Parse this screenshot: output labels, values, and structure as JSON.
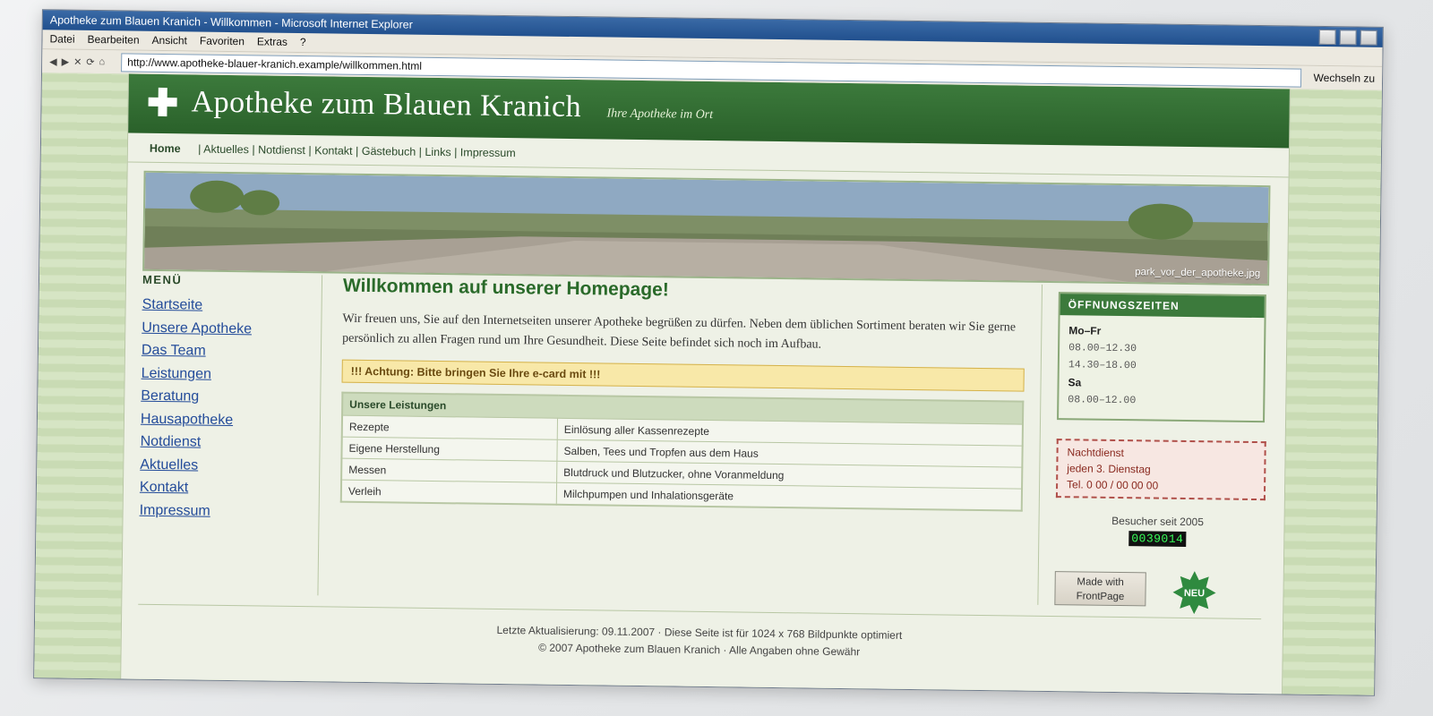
{
  "browser": {
    "window_title": "Apotheke zum Blauen Kranich - Willkommen - Microsoft Internet Explorer",
    "menu": [
      "Datei",
      "Bearbeiten",
      "Ansicht",
      "Favoriten",
      "Extras",
      "?"
    ],
    "nav_icons": [
      "◀",
      "▶",
      "✕",
      "⟳",
      "⌂"
    ],
    "url": "http://www.apotheke-blauer-kranich.example/willkommen.html",
    "go_label": "Wechseln zu"
  },
  "site": {
    "title": "Apotheke zum Blauen Kranich",
    "slogan": "Ihre Apotheke im Ort",
    "brand_green": "#2f6b2f"
  },
  "topnav": {
    "active": "Home",
    "items": [
      "Aktuelles",
      "Notdienst",
      "Kontakt",
      "Gästebuch",
      "Links",
      "Impressum"
    ]
  },
  "banner": {
    "caption": "park_vor_der_apotheke.jpg"
  },
  "leftmenu": {
    "heading": "MENÜ",
    "items": [
      "Startseite",
      "Unsere Apotheke",
      "Das Team",
      "Leistungen",
      "Beratung",
      "Hausapotheke",
      "Notdienst",
      "Aktuelles",
      "Kontakt",
      "Impressum"
    ]
  },
  "main": {
    "heading": "Willkommen auf unserer Homepage!",
    "intro": "Wir freuen uns, Sie auf den Internetseiten unserer Apotheke begrüßen zu dürfen. Neben dem üblichen Sortiment beraten wir Sie gerne persönlich zu allen Fragen rund um Ihre Gesundheit. Diese Seite befindet sich noch im Aufbau.",
    "notice": "!!! Achtung: Bitte bringen Sie Ihre e-card mit !!!",
    "services": {
      "header": "Unsere Leistungen",
      "rows": [
        [
          "Rezepte",
          "Einlösung aller Kassenrezepte"
        ],
        [
          "Eigene Herstellung",
          "Salben, Tees und Tropfen aus dem Haus"
        ],
        [
          "Messen",
          "Blutdruck und Blutzucker, ohne Voranmeldung"
        ],
        [
          "Verleih",
          "Milchpumpen und Inhalationsgeräte"
        ]
      ]
    }
  },
  "hours": {
    "heading": "ÖFFNUNGSZEITEN",
    "weekday_label": "Mo–Fr",
    "weekday_times": [
      "08.00–12.30",
      "14.30–18.00"
    ],
    "sat_label": "Sa",
    "sat_times": [
      "08.00–12.00"
    ]
  },
  "nightduty": {
    "lines": [
      "Nachtdienst",
      "jeden 3. Dienstag",
      "Tel. 0 00 / 00 00 00"
    ]
  },
  "visitors": {
    "label": "Besucher seit 2005",
    "count": "0039014"
  },
  "frontpage_button": [
    "Made with",
    "FrontPage"
  ],
  "new_badge": "NEU",
  "footer": {
    "line1": "Letzte Aktualisierung: 09.11.2007  ·  Diese Seite ist für 1024 x 768 Bildpunkte optimiert",
    "line2": "© 2007 Apotheke zum Blauen Kranich  ·  Alle Angaben ohne Gewähr"
  }
}
